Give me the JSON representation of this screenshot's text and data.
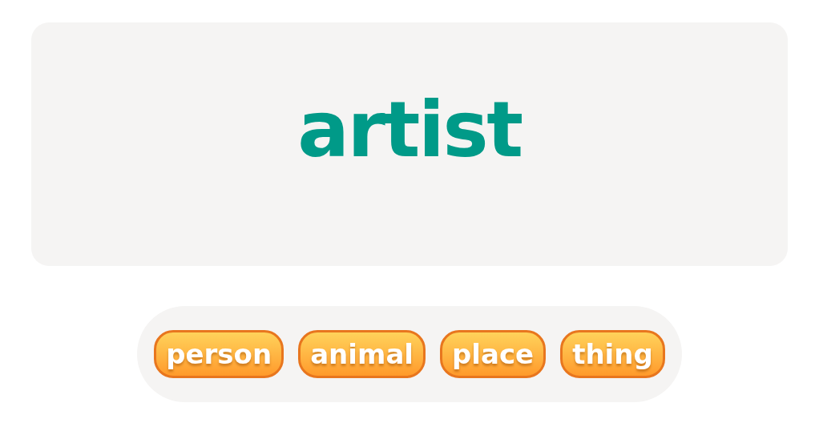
{
  "word_card": {
    "word": "artist"
  },
  "choices": [
    "person",
    "animal",
    "place",
    "thing"
  ]
}
